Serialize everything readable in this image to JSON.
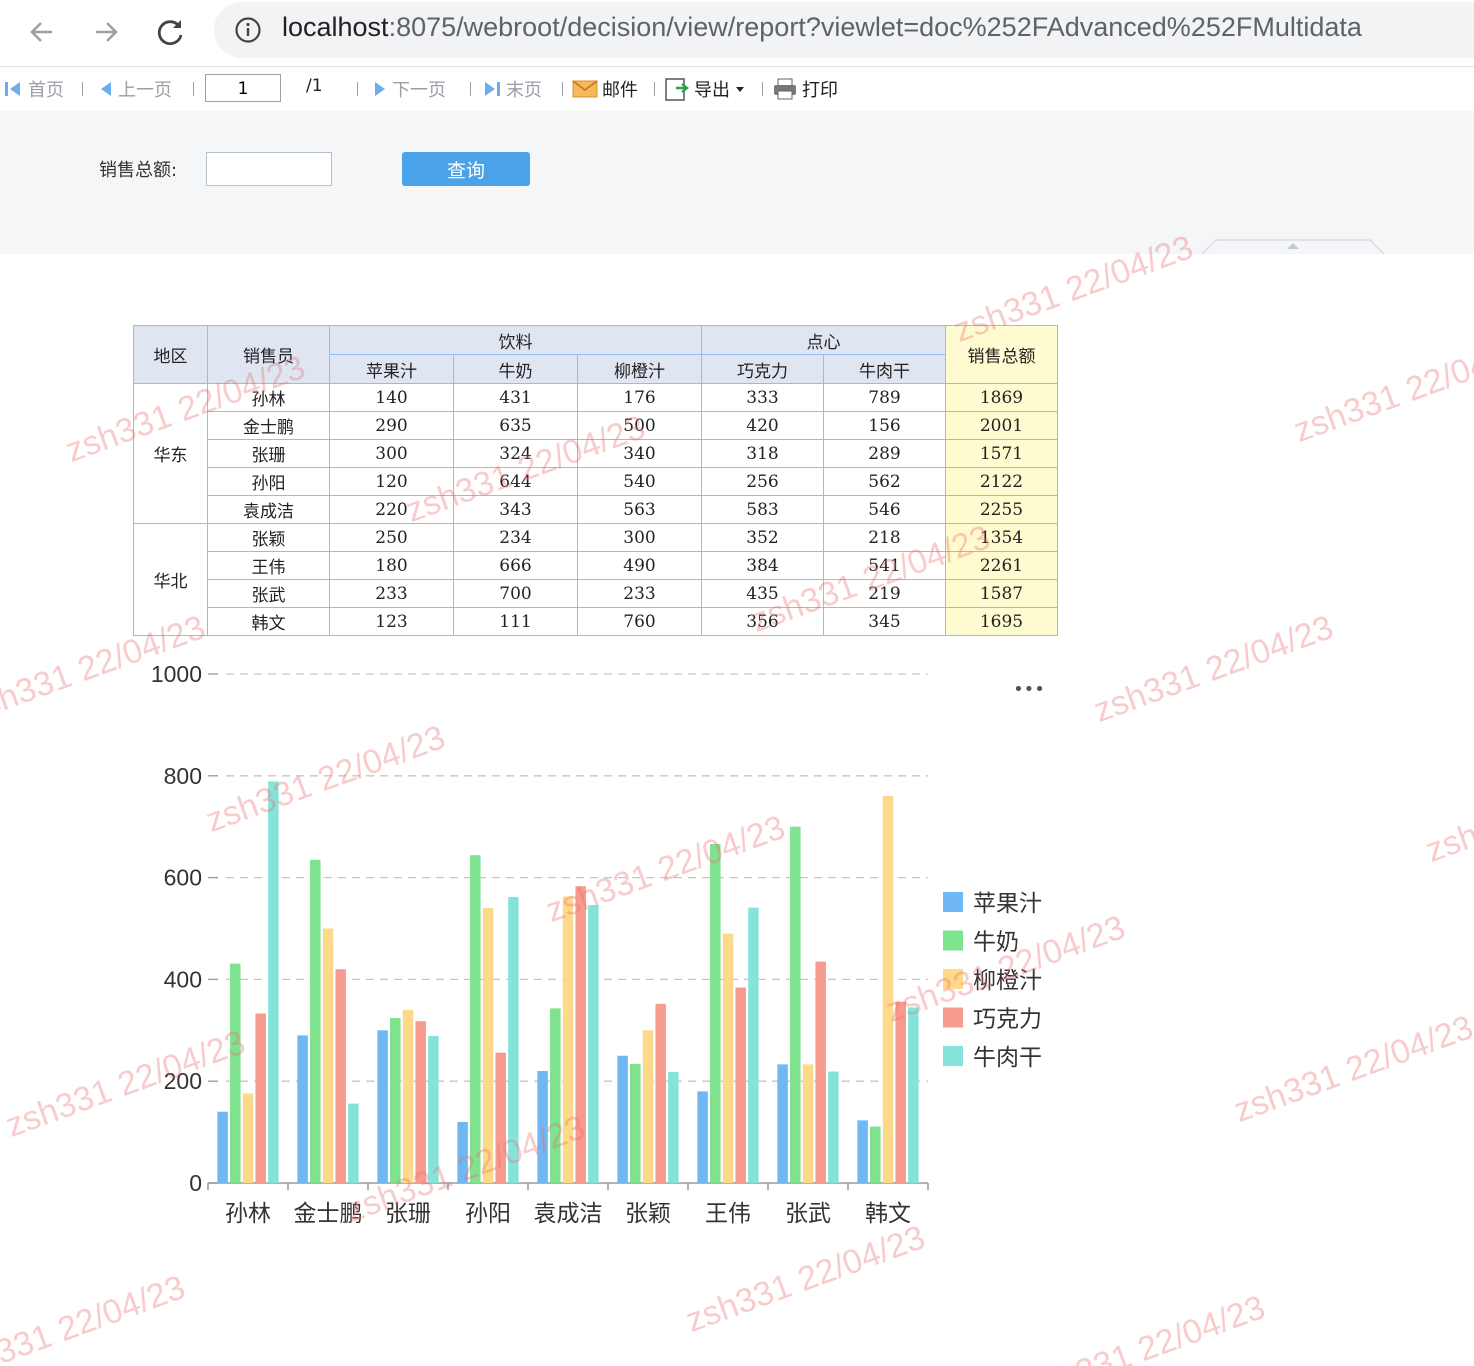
{
  "browser": {
    "url_host": "localhost",
    "url_rest": ":8075/webroot/decision/view/report?viewlet=doc%252FAdvanced%252FMultidata"
  },
  "toolbar": {
    "first": "首页",
    "prev": "上一页",
    "page_value": "1",
    "page_total": "/1",
    "next": "下一页",
    "last": "末页",
    "email": "邮件",
    "export": "导出",
    "print": "打印"
  },
  "params": {
    "sales_total_label": "销售总额:",
    "query_button": "查询"
  },
  "table": {
    "h_region": "地区",
    "h_seller": "销售员",
    "h_drinks": "饮料",
    "h_snacks": "点心",
    "h_total": "销售总额",
    "products": [
      "苹果汁",
      "牛奶",
      "柳橙汁",
      "巧克力",
      "牛肉干"
    ],
    "regions": [
      {
        "name": "华东",
        "span": 5
      },
      {
        "name": "华北",
        "span": 4
      }
    ],
    "rows": [
      {
        "seller": "孙林",
        "values": [
          "140",
          "431",
          "176",
          "333",
          "789"
        ],
        "total": "1869"
      },
      {
        "seller": "金士鹏",
        "values": [
          "290",
          "635",
          "500",
          "420",
          "156"
        ],
        "total": "2001"
      },
      {
        "seller": "张珊",
        "values": [
          "300",
          "324",
          "340",
          "318",
          "289"
        ],
        "total": "1571"
      },
      {
        "seller": "孙阳",
        "values": [
          "120",
          "644",
          "540",
          "256",
          "562"
        ],
        "total": "2122"
      },
      {
        "seller": "袁成洁",
        "values": [
          "220",
          "343",
          "563",
          "583",
          "546"
        ],
        "total": "2255"
      },
      {
        "seller": "张颖",
        "values": [
          "250",
          "234",
          "300",
          "352",
          "218"
        ],
        "total": "1354"
      },
      {
        "seller": "王伟",
        "values": [
          "180",
          "666",
          "490",
          "384",
          "541"
        ],
        "total": "2261"
      },
      {
        "seller": "张武",
        "values": [
          "233",
          "700",
          "233",
          "435",
          "219"
        ],
        "total": "1587"
      },
      {
        "seller": "韩文",
        "values": [
          "123",
          "111",
          "760",
          "356",
          "345"
        ],
        "total": "1695"
      }
    ]
  },
  "chart_data": {
    "type": "bar",
    "categories": [
      "孙林",
      "金士鹏",
      "张珊",
      "孙阳",
      "袁成洁",
      "张颖",
      "王伟",
      "张武",
      "韩文"
    ],
    "series": [
      {
        "name": "苹果汁",
        "color": "#6fb8f4",
        "values": [
          140,
          290,
          300,
          120,
          220,
          250,
          180,
          233,
          123
        ]
      },
      {
        "name": "牛奶",
        "color": "#7fe28f",
        "values": [
          431,
          635,
          324,
          644,
          343,
          234,
          666,
          700,
          111
        ]
      },
      {
        "name": "柳橙汁",
        "color": "#fdd98a",
        "values": [
          176,
          500,
          340,
          540,
          563,
          300,
          490,
          233,
          760
        ]
      },
      {
        "name": "巧克力",
        "color": "#f79b8f",
        "values": [
          333,
          420,
          318,
          256,
          583,
          352,
          384,
          435,
          356
        ]
      },
      {
        "name": "牛肉干",
        "color": "#86e3dc",
        "values": [
          789,
          156,
          289,
          562,
          546,
          218,
          541,
          219,
          345
        ]
      }
    ],
    "yticks": [
      "0",
      "200",
      "400",
      "600",
      "800",
      "1000"
    ],
    "ylim": [
      0,
      1000
    ],
    "grid": true,
    "legend_position": "right",
    "more_label": "•••"
  },
  "watermark": {
    "text": "zsh331 22/04/23"
  }
}
